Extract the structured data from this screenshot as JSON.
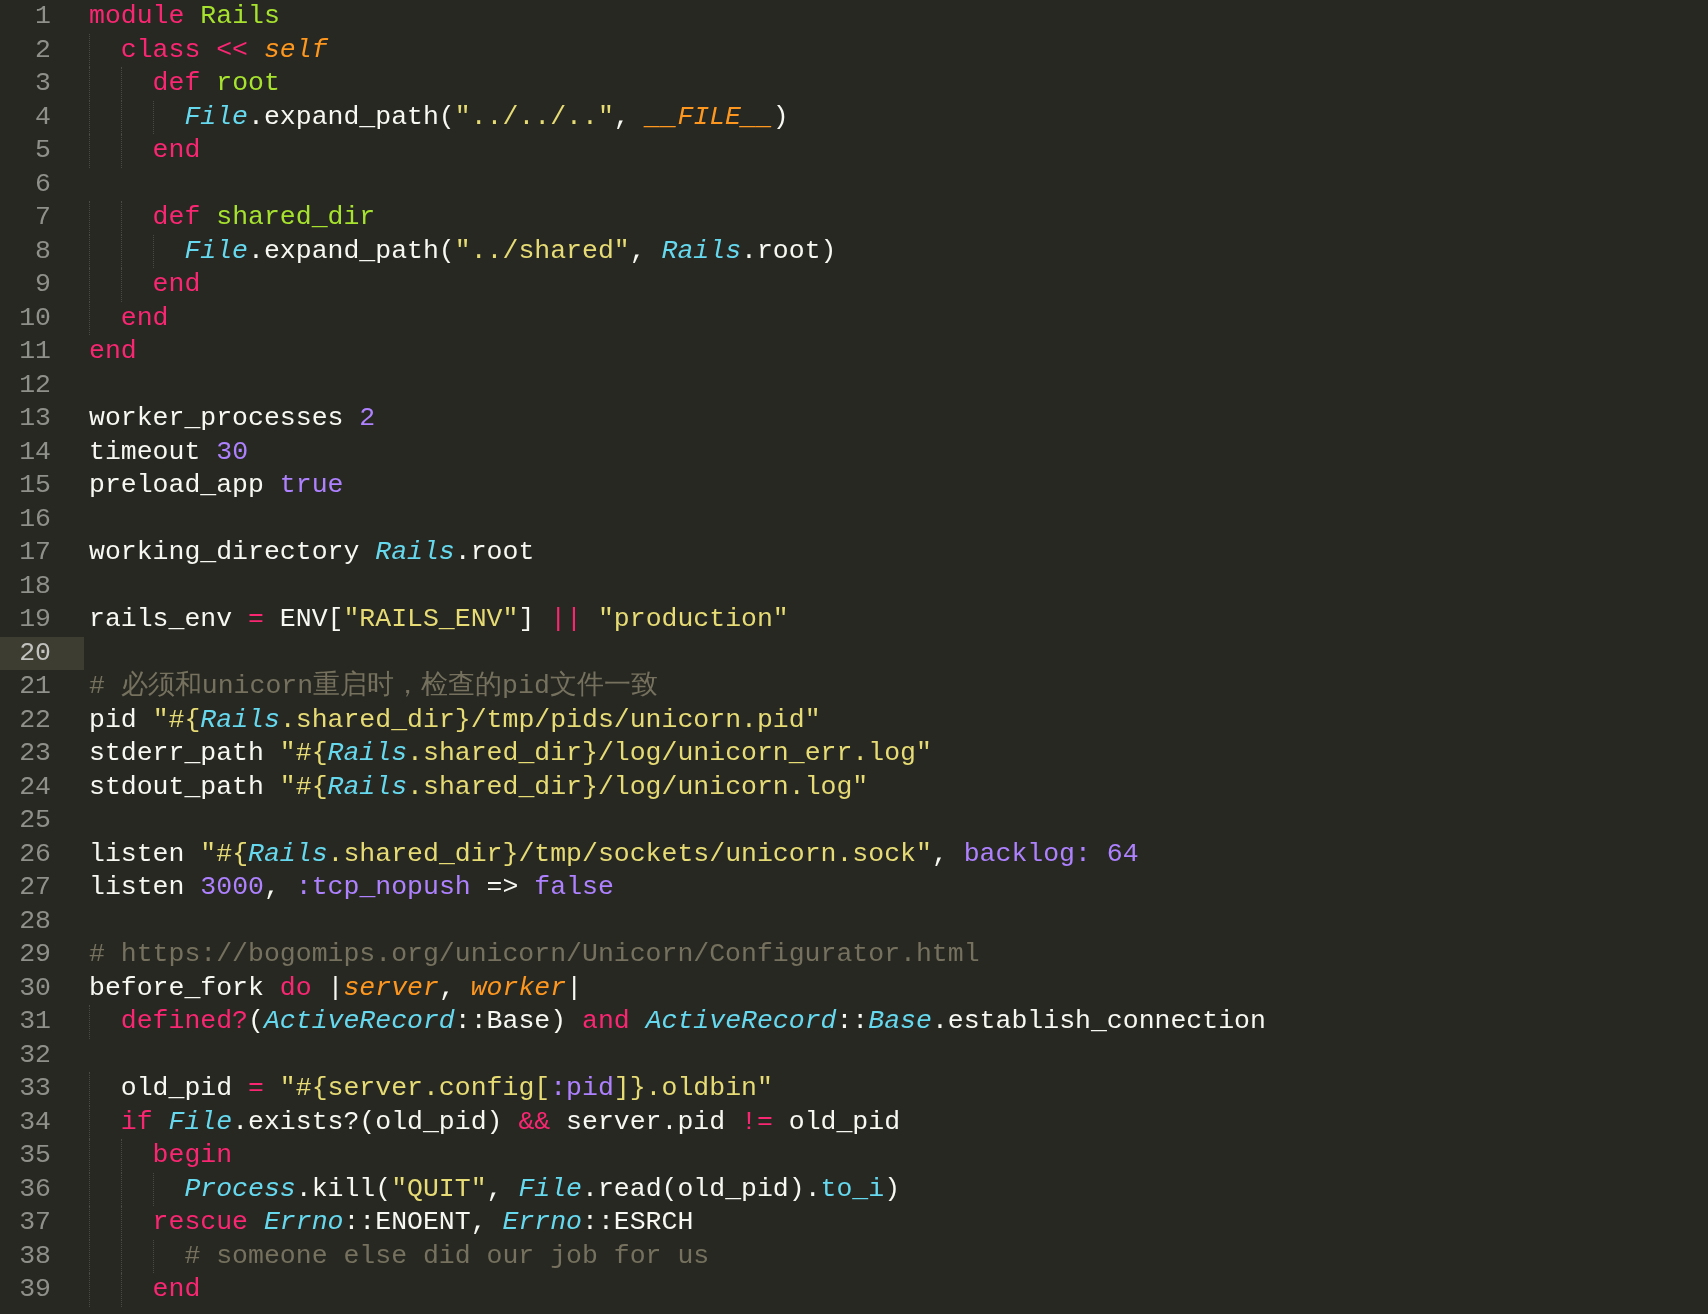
{
  "editor": {
    "lines": [
      {
        "number": "1",
        "current": false,
        "tokens": [
          {
            "kind": "keyword",
            "text": "module "
          },
          {
            "kind": "function",
            "text": "Rails"
          }
        ]
      },
      {
        "number": "2",
        "current": false,
        "tokens": [
          {
            "kind": "keyword",
            "text": "  class << "
          },
          {
            "kind": "variable",
            "text": "self"
          }
        ]
      },
      {
        "number": "3",
        "current": false,
        "tokens": [
          {
            "kind": "keyword",
            "text": "    def "
          },
          {
            "kind": "function",
            "text": "root"
          }
        ]
      },
      {
        "number": "4",
        "current": false,
        "tokens": [
          {
            "kind": "class",
            "text": "      File"
          },
          {
            "kind": "plain",
            "text": ".expand_path("
          },
          {
            "kind": "string",
            "text": "\"../../..\""
          },
          {
            "kind": "plain",
            "text": ", "
          },
          {
            "kind": "variable",
            "text": "__FILE__"
          },
          {
            "kind": "plain",
            "text": ")"
          }
        ]
      },
      {
        "number": "5",
        "current": false,
        "tokens": [
          {
            "kind": "keyword",
            "text": "    end"
          }
        ]
      },
      {
        "number": "6",
        "current": false
      },
      {
        "number": "7",
        "current": false,
        "tokens": [
          {
            "kind": "keyword",
            "text": "    def "
          },
          {
            "kind": "function",
            "text": "shared_dir"
          }
        ]
      },
      {
        "number": "8",
        "current": false,
        "tokens": [
          {
            "kind": "class",
            "text": "      File"
          },
          {
            "kind": "plain",
            "text": ".expand_path("
          },
          {
            "kind": "string",
            "text": "\"../shared\""
          },
          {
            "kind": "plain",
            "text": ", "
          },
          {
            "kind": "class",
            "text": "Rails"
          },
          {
            "kind": "plain",
            "text": ".root)"
          }
        ]
      },
      {
        "number": "9",
        "current": false,
        "tokens": [
          {
            "kind": "keyword",
            "text": "    end"
          }
        ]
      },
      {
        "number": "10",
        "current": false,
        "tokens": [
          {
            "kind": "keyword",
            "text": "  end"
          }
        ]
      },
      {
        "number": "11",
        "current": false,
        "tokens": [
          {
            "kind": "keyword",
            "text": "end"
          }
        ]
      },
      {
        "number": "12",
        "current": false
      },
      {
        "number": "13",
        "current": false,
        "tokens": [
          {
            "kind": "plain",
            "text": "worker_processes "
          },
          {
            "kind": "constant",
            "text": "2"
          }
        ]
      },
      {
        "number": "14",
        "current": false,
        "tokens": [
          {
            "kind": "plain",
            "text": "timeout "
          },
          {
            "kind": "constant",
            "text": "30"
          }
        ]
      },
      {
        "number": "15",
        "current": false,
        "tokens": [
          {
            "kind": "plain",
            "text": "preload_app "
          },
          {
            "kind": "constant",
            "text": "true"
          }
        ]
      },
      {
        "number": "16",
        "current": false
      },
      {
        "number": "17",
        "current": false,
        "tokens": [
          {
            "kind": "plain",
            "text": "working_directory "
          },
          {
            "kind": "class",
            "text": "Rails"
          },
          {
            "kind": "plain",
            "text": ".root"
          }
        ]
      },
      {
        "number": "18",
        "current": false
      },
      {
        "number": "19",
        "current": false,
        "tokens": [
          {
            "kind": "plain",
            "text": "rails_env "
          },
          {
            "kind": "keyword",
            "text": "="
          },
          {
            "kind": "plain",
            "text": " ENV["
          },
          {
            "kind": "string",
            "text": "\"RAILS_ENV\""
          },
          {
            "kind": "plain",
            "text": "] "
          },
          {
            "kind": "keyword",
            "text": "||"
          },
          {
            "kind": "string",
            "text": " \"production\""
          }
        ]
      },
      {
        "number": "20",
        "current": true
      },
      {
        "number": "21",
        "current": false,
        "tokens": [
          {
            "kind": "comment",
            "text": "# 必须和unicorn重启时，检查的pid文件一致"
          }
        ]
      },
      {
        "number": "22",
        "current": false,
        "tokens": [
          {
            "kind": "plain",
            "text": "pid "
          },
          {
            "kind": "string",
            "text": "\"#{"
          },
          {
            "kind": "class",
            "text": "Rails"
          },
          {
            "kind": "string",
            "text": ".shared_dir}/tmp/pids/unicorn.pid\""
          }
        ]
      },
      {
        "number": "23",
        "current": false,
        "tokens": [
          {
            "kind": "plain",
            "text": "stderr_path "
          },
          {
            "kind": "string",
            "text": "\"#{"
          },
          {
            "kind": "class",
            "text": "Rails"
          },
          {
            "kind": "string",
            "text": ".shared_dir}/log/unicorn_err.log\""
          }
        ]
      },
      {
        "number": "24",
        "current": false,
        "tokens": [
          {
            "kind": "plain",
            "text": "stdout_path "
          },
          {
            "kind": "string",
            "text": "\"#{"
          },
          {
            "kind": "class",
            "text": "Rails"
          },
          {
            "kind": "string",
            "text": ".shared_dir}/log/unicorn.log\""
          }
        ]
      },
      {
        "number": "25",
        "current": false
      },
      {
        "number": "26",
        "current": false,
        "tokens": [
          {
            "kind": "plain",
            "text": "listen "
          },
          {
            "kind": "string",
            "text": "\"#{"
          },
          {
            "kind": "class",
            "text": "Rails"
          },
          {
            "kind": "string",
            "text": ".shared_dir}/tmp/sockets/unicorn.sock\""
          },
          {
            "kind": "plain",
            "text": ", "
          },
          {
            "kind": "constant",
            "text": "backlog: 64"
          }
        ]
      },
      {
        "number": "27",
        "current": false,
        "tokens": [
          {
            "kind": "plain",
            "text": "listen "
          },
          {
            "kind": "constant",
            "text": "3000"
          },
          {
            "kind": "plain",
            "text": ", "
          },
          {
            "kind": "constant",
            "text": ":tcp_nopush"
          },
          {
            "kind": "plain",
            "text": " => "
          },
          {
            "kind": "constant",
            "text": "false"
          }
        ]
      },
      {
        "number": "28",
        "current": false
      },
      {
        "number": "29",
        "current": false,
        "tokens": [
          {
            "kind": "comment",
            "text": "# https://bogomips.org/unicorn/Unicorn/Configurator.html"
          }
        ]
      },
      {
        "number": "30",
        "current": false,
        "tokens": [
          {
            "kind": "plain",
            "text": "before_fork "
          },
          {
            "kind": "keyword",
            "text": "do"
          },
          {
            "kind": "plain",
            "text": " |"
          },
          {
            "kind": "variable",
            "text": "server"
          },
          {
            "kind": "plain",
            "text": ", "
          },
          {
            "kind": "variable",
            "text": "worker"
          },
          {
            "kind": "plain",
            "text": "|"
          }
        ]
      },
      {
        "number": "31",
        "current": false,
        "tokens": [
          {
            "kind": "keyword",
            "text": "  defined?"
          },
          {
            "kind": "plain",
            "text": "("
          },
          {
            "kind": "class",
            "text": "ActiveRecord"
          },
          {
            "kind": "plain",
            "text": "::Base) "
          },
          {
            "kind": "keyword",
            "text": "and"
          },
          {
            "kind": "class",
            "text": " ActiveRecord"
          },
          {
            "kind": "plain",
            "text": "::"
          },
          {
            "kind": "class",
            "text": "Base"
          },
          {
            "kind": "plain",
            "text": ".establish_connection"
          }
        ]
      },
      {
        "number": "32",
        "current": false
      },
      {
        "number": "33",
        "current": false,
        "tokens": [
          {
            "kind": "plain",
            "text": "  old_pid "
          },
          {
            "kind": "keyword",
            "text": "="
          },
          {
            "kind": "string",
            "text": " \"#{server.config["
          },
          {
            "kind": "constant",
            "text": ":pid"
          },
          {
            "kind": "string",
            "text": "]}.oldbin\""
          }
        ]
      },
      {
        "number": "34",
        "current": false,
        "tokens": [
          {
            "kind": "keyword",
            "text": "  if"
          },
          {
            "kind": "class",
            "text": " File"
          },
          {
            "kind": "plain",
            "text": ".exists?(old_pid) "
          },
          {
            "kind": "keyword",
            "text": "&&"
          },
          {
            "kind": "plain",
            "text": " server.pid "
          },
          {
            "kind": "keyword",
            "text": "!="
          },
          {
            "kind": "plain",
            "text": " old_pid"
          }
        ]
      },
      {
        "number": "35",
        "current": false,
        "tokens": [
          {
            "kind": "keyword",
            "text": "    begin"
          }
        ]
      },
      {
        "number": "36",
        "current": false,
        "tokens": [
          {
            "kind": "class",
            "text": "      Process"
          },
          {
            "kind": "plain",
            "text": ".kill("
          },
          {
            "kind": "string",
            "text": "\"QUIT\""
          },
          {
            "kind": "plain",
            "text": ", "
          },
          {
            "kind": "class",
            "text": "File"
          },
          {
            "kind": "plain",
            "text": ".read(old_pid)."
          },
          {
            "kind": "method",
            "text": "to_i"
          },
          {
            "kind": "plain",
            "text": ")"
          }
        ]
      },
      {
        "number": "37",
        "current": false,
        "tokens": [
          {
            "kind": "keyword",
            "text": "    rescue"
          },
          {
            "kind": "class",
            "text": " Errno"
          },
          {
            "kind": "plain",
            "text": "::ENOENT, "
          },
          {
            "kind": "class",
            "text": "Errno"
          },
          {
            "kind": "plain",
            "text": "::ESRCH"
          }
        ]
      },
      {
        "number": "38",
        "current": false,
        "tokens": [
          {
            "kind": "comment",
            "text": "      # someone else did our job for us"
          }
        ]
      },
      {
        "number": "39",
        "current": false,
        "tokens": [
          {
            "kind": "keyword",
            "text": "    end"
          }
        ]
      }
    ]
  }
}
